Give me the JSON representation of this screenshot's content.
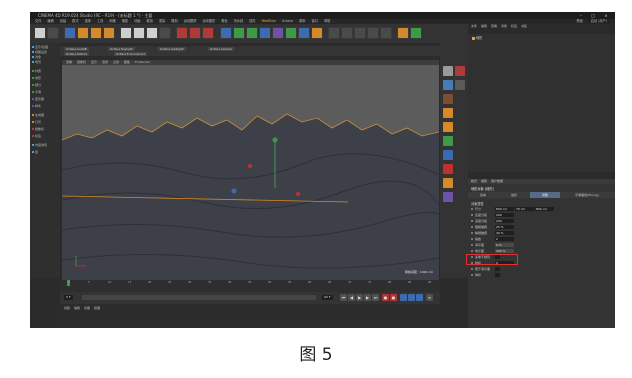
{
  "window": {
    "title": "CINEMA 4D R19.024 Studio (RC - R19) - [未标题 1 *] - 主要",
    "minimize_label": "–",
    "maximize_label": "□",
    "close_label": "×"
  },
  "menubar": {
    "items": [
      "文件",
      "编辑",
      "创建",
      "模式",
      "选择",
      "工具",
      "网格",
      "捕捉",
      "动画",
      "模拟",
      "渲染",
      "雕刻",
      "运动跟踪",
      "运动图形",
      "角色",
      "流水线",
      "插件",
      "RealFlow",
      "Octane",
      "脚本",
      "窗口",
      "帮助"
    ],
    "right_items": [
      "界面",
      "启动 (用户)"
    ]
  },
  "left_panel": {
    "items": [
      "显示/隐藏",
      "视图设置",
      "对象",
      "场景",
      "材质",
      "地形",
      "细分",
      "平滑",
      "变形器",
      "样条",
      "生成器",
      "灯光",
      "摄像机",
      "标签",
      "内容浏览",
      "层"
    ]
  },
  "viewport_tabs": {
    "items": [
      "Octane LiveDB",
      "Octane Daylight",
      "Octane Arealight",
      "Octane Camera",
      "Octane Texture",
      "Octane Environment"
    ]
  },
  "viewport": {
    "menu": [
      "查看",
      "摄像机",
      "显示",
      "选项",
      "过滤",
      "面板",
      "ProRender"
    ],
    "label": "透视视图",
    "scale_text": "网格间距：1000 cm"
  },
  "timeline": {
    "ticks": [
      "0",
      "5",
      "10",
      "15",
      "20",
      "25",
      "30",
      "35",
      "40",
      "45",
      "50",
      "55",
      "60",
      "65",
      "70",
      "75",
      "80",
      "85",
      "90"
    ],
    "start_field": "0 F",
    "end_field": "90 F",
    "current_frame": "0 F"
  },
  "material_manager": {
    "menu": [
      "创建",
      "编辑",
      "功能",
      "纹理"
    ]
  },
  "object_manager": {
    "menu": [
      "文件",
      "编辑",
      "查看",
      "对象",
      "标签",
      "书签"
    ],
    "object_name": "地形"
  },
  "attribute_manager": {
    "menu": [
      "模式",
      "编辑",
      "用户数据"
    ],
    "object_title": "地形对象 [地形]",
    "tabs": [
      "基本",
      "坐标",
      "对象",
      "平滑着色(Phong)"
    ],
    "active_tab": "对象",
    "section_title": "对象属性",
    "params": [
      {
        "label": "尺寸",
        "value": "800 cm",
        "extra": [
          "70 cm",
          "800 cm"
        ]
      },
      {
        "label": "宽度分段",
        "value": "200"
      },
      {
        "label": "深度分段",
        "value": "200"
      },
      {
        "label": "粗糙皱褶",
        "value": "25 %"
      },
      {
        "label": "精细皱褶",
        "value": "40 %"
      },
      {
        "label": "缩放",
        "value": "2"
      },
      {
        "label": "海平面",
        "value": "0 %"
      },
      {
        "label": "地平面",
        "value": "100 %"
      },
      {
        "label": "多重不规则",
        "value": ""
      },
      {
        "label": "随机",
        "value": "0"
      },
      {
        "label": "限于海平面",
        "value": ""
      },
      {
        "label": "球状",
        "value": ""
      }
    ],
    "highlighted_params": [
      "地平面",
      "海平面"
    ]
  },
  "caption": "图 5",
  "colors": {
    "accent_blue": "#556b88",
    "highlight_red": "#e03030",
    "terrain": "#4a4d55",
    "sky": "#5a5a5a"
  }
}
